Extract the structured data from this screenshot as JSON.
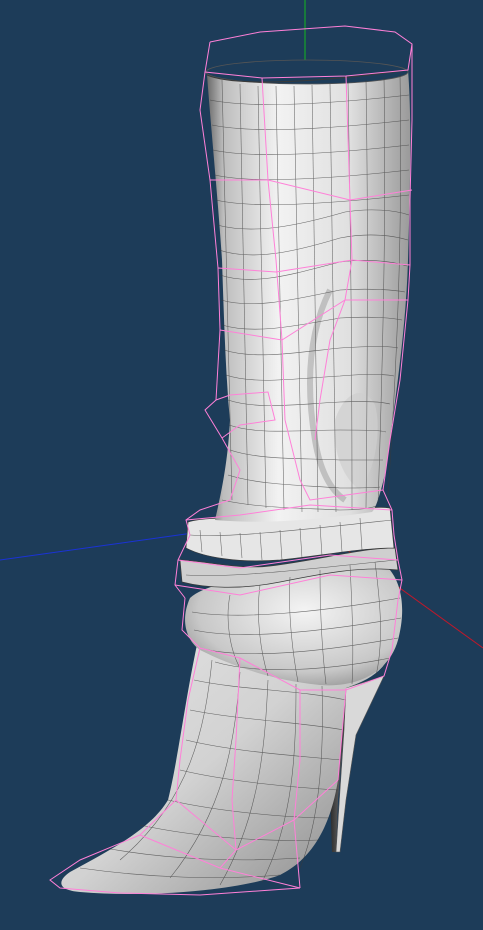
{
  "viewport": {
    "background_color": "#1d3c59",
    "axis_colors": {
      "x_axis": "#c0182a",
      "y_axis": "#12b81e",
      "z_axis": "#1a33d6"
    },
    "cage_color": "#ff80d8",
    "mesh_line_color": "#3a3a3a",
    "subject": "boot-model"
  }
}
